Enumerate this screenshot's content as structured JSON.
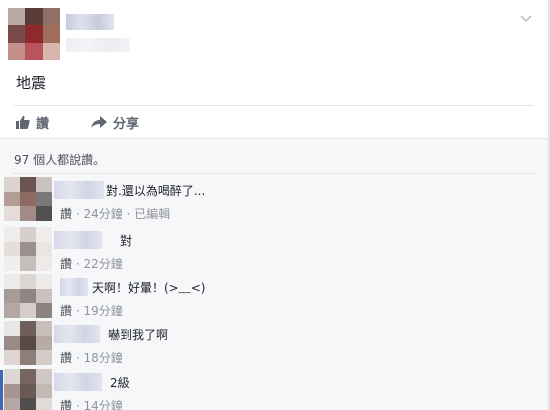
{
  "post": {
    "text": "地震",
    "actions": {
      "like_label": "讚",
      "share_label": "分享"
    }
  },
  "comments_section": {
    "likes_summary": "97 個人都說讚。",
    "comments": [
      {
        "text": "對.還以為喝醉了...",
        "like_label": "讚",
        "time": "24分鐘",
        "edited": "已編輯"
      },
      {
        "text": "對",
        "like_label": "讚",
        "time": "22分鐘"
      },
      {
        "text": "天啊！好暈！(>﹏<)",
        "like_label": "讚",
        "time": "19分鐘"
      },
      {
        "text": "嚇到我了啊",
        "like_label": "讚",
        "time": "18分鐘"
      },
      {
        "text": "2級",
        "like_label": "讚",
        "time": "14分鐘"
      }
    ]
  },
  "colors": {
    "accent": "#4267b2",
    "meta_text": "#90949c",
    "body_text": "#1d2129"
  },
  "icons": [
    "chevron-down-icon",
    "thumbs-up-icon",
    "share-arrow-icon",
    "avatar"
  ]
}
